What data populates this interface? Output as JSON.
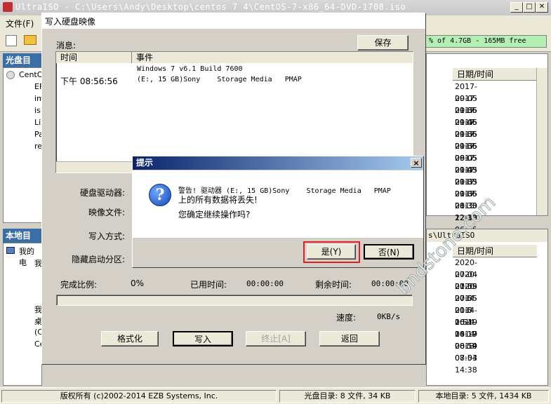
{
  "window": {
    "title": "UltraISO - C:\\Users\\Andy\\Desktop\\centos 7 4\\CentOS-7-x86_64-DVD-1708.iso"
  },
  "menu": {
    "file": "文件(F)"
  },
  "capacity": {
    "text": "% of 4.7GB - 165MB free"
  },
  "panes": {
    "iso_dir_header": "光盘目录:",
    "local_dir_header": "本地目录:",
    "iso_tree": [
      {
        "label": "CentO"
      },
      {
        "label": "EF"
      },
      {
        "label": "im"
      },
      {
        "label": "is"
      },
      {
        "label": "Li"
      },
      {
        "label": "Pa"
      },
      {
        "label": "re"
      }
    ],
    "local_tree": [
      {
        "label": "我的电"
      },
      {
        "label": "我"
      },
      {
        "label": "我"
      },
      {
        "label": "桌"
      },
      {
        "label": "(C"
      },
      {
        "label": "Ce"
      }
    ],
    "local_path": "s\\UltraISO",
    "date_header": "日期/时间",
    "iso_dates": [
      "2017-09-05 21:36",
      "2017-09-05 21:46",
      "2017-09-05 21:36",
      "2017-09-05 21:36",
      "2017-09-05 06:05",
      "2017-09-05 21:43",
      "2017-09-05 21:33",
      "2017-09-05 21:36",
      "2017-09-05 21:33",
      "2017-08-30 22:33",
      "2015-12-10 06:35"
    ],
    "local_dates": [
      "2020-07-04 21:59",
      "2020-07-05 20:5",
      "2020-07-05 20:5",
      "2014-01-0 1:54",
      "2014-06-19 14:17",
      "2014-08-19 08:54",
      "2014-08-19 08:54",
      "2013-07-03 14:38"
    ]
  },
  "status": {
    "copyright": "版权所有 (c)2002-2014 EZB Systems, Inc.",
    "iso_summary": "光盘目录: 8 文件, 34 KB",
    "local_summary": "本地目录: 5 文件, 1434 KB"
  },
  "burn_dialog": {
    "title": "写入硬盘映像",
    "message_label": "消息:",
    "save_button": "保存",
    "col_time": "时间",
    "col_event": "事件",
    "log": [
      {
        "time": "",
        "event": "Windows 7 v6.1 Build 7600"
      },
      {
        "time": "下午 08:56:56",
        "event": "(E:, 15 GB)Sony    Storage Media   PMAP"
      }
    ],
    "drive_label": "硬盘驱动器:",
    "image_label": "映像文件:",
    "write_mode_label": "写入方式:",
    "hidden_partition_label": "隐藏启动分区:",
    "progress_label": "完成比例:",
    "progress_value": "0%",
    "elapsed_label": "已用时间:",
    "elapsed_value": "00:00:00",
    "remaining_label": "剩余时间:",
    "remaining_value": "00:00:00",
    "speed_label": "速度:",
    "speed_value": "0KB/s",
    "progress_fraction": 0,
    "buttons": {
      "format": "格式化",
      "write": "写入",
      "stop": "终止[A]",
      "back": "返回"
    }
  },
  "prompt_dialog": {
    "title": "提示",
    "line1": "警告! 驱动器 (E:, 15 GB)Sony    Storage Media   PMAP",
    "line2": "上的所有数据将丢失!",
    "line3": "您确定继续操作吗?",
    "yes_button": "是(Y)",
    "no_button": "否(N)",
    "close": "×"
  },
  "watermark": "bndstone.com"
}
